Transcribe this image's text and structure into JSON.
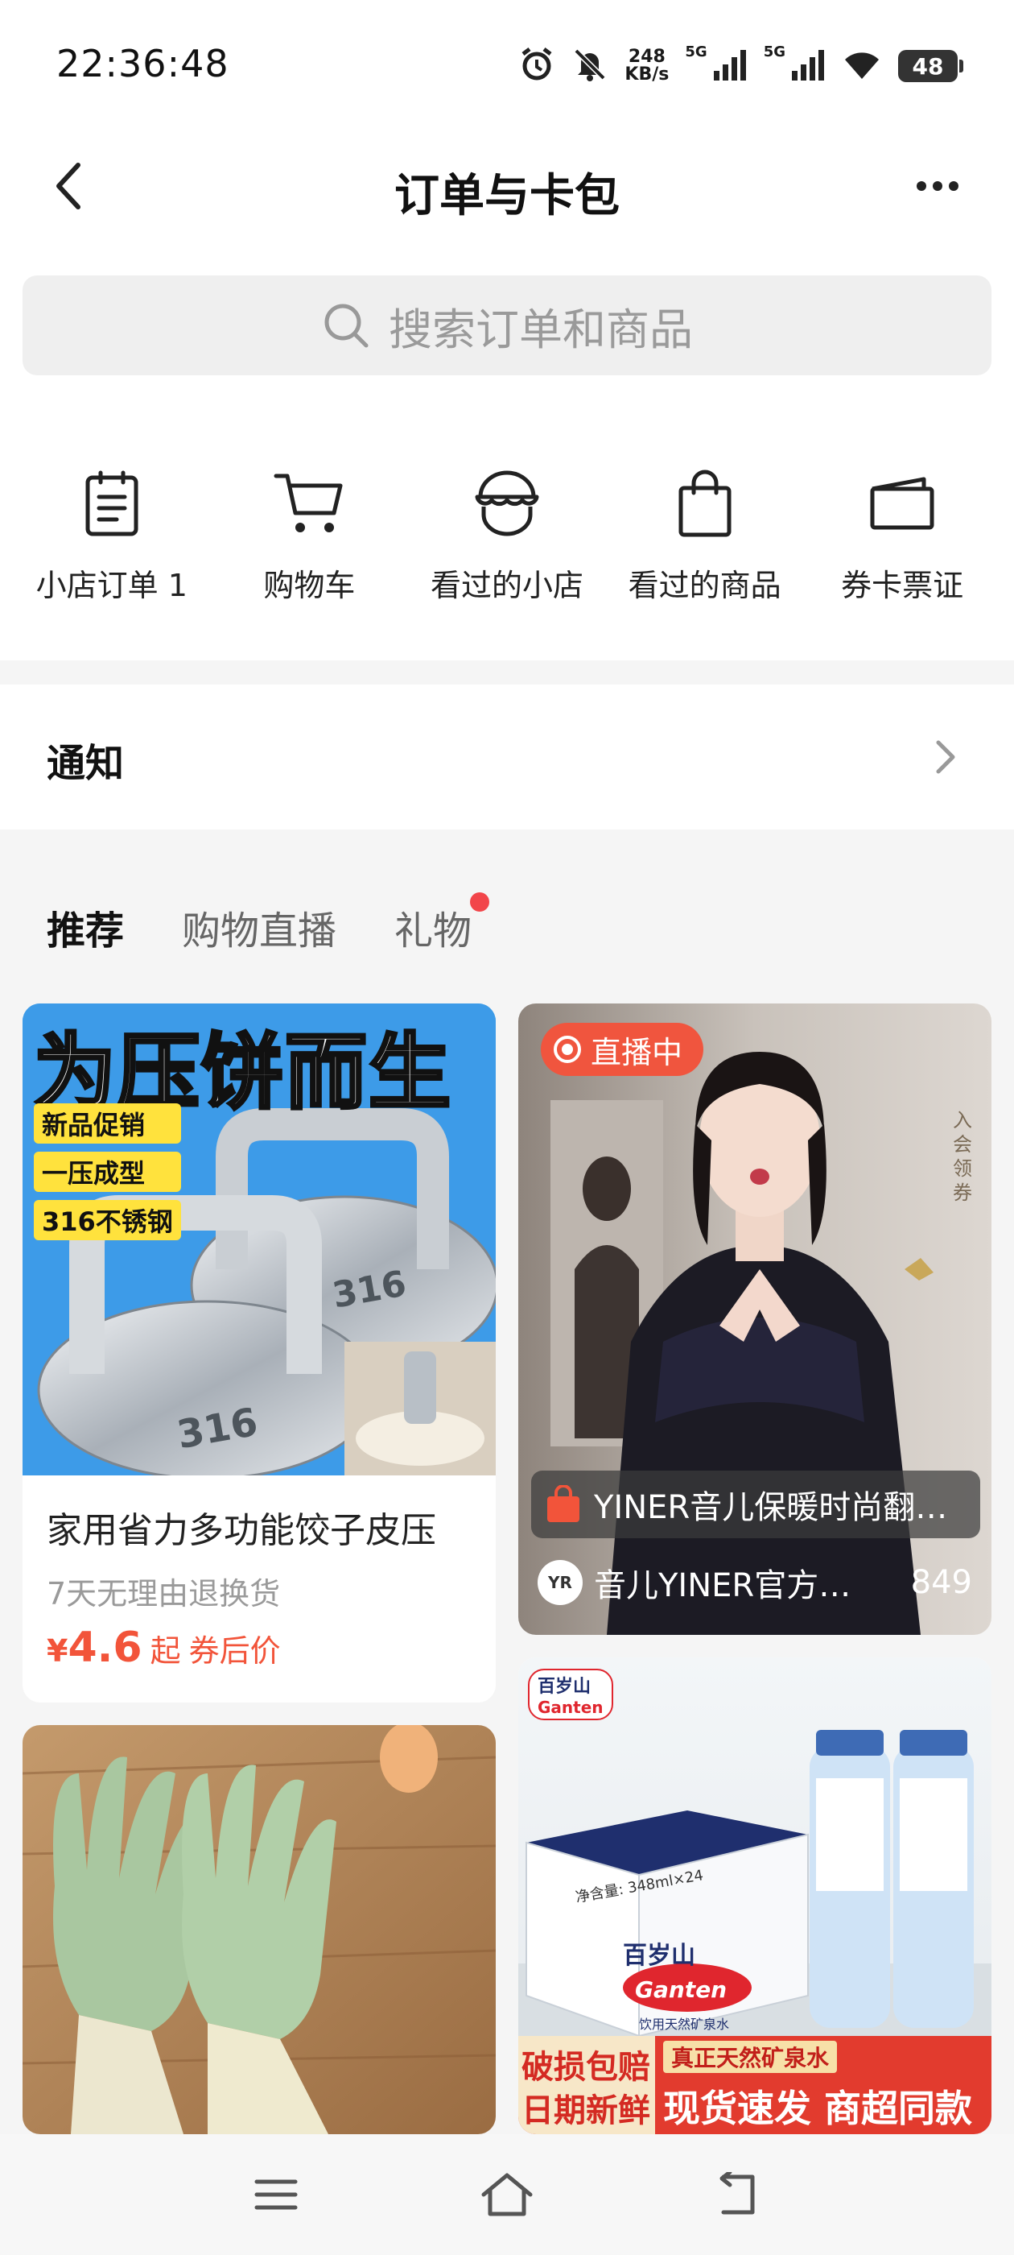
{
  "status_bar": {
    "time": "22:36:48",
    "net_speed_value": "248",
    "net_speed_unit": "KB/s",
    "signal_1_label": "5G",
    "signal_2_label": "5G",
    "battery": "48"
  },
  "nav": {
    "title": "订单与卡包"
  },
  "search": {
    "placeholder": "搜索订单和商品"
  },
  "shortcuts": [
    {
      "label": "小店订单 1",
      "icon": "clipboard-icon"
    },
    {
      "label": "购物车",
      "icon": "cart-icon"
    },
    {
      "label": "看过的小店",
      "icon": "shop-icon"
    },
    {
      "label": "看过的商品",
      "icon": "bag-icon"
    },
    {
      "label": "券卡票证",
      "icon": "wallet-icon"
    }
  ],
  "notice": {
    "label": "通知"
  },
  "tabs": [
    {
      "label": "推荐",
      "active": true
    },
    {
      "label": "购物直播",
      "active": false
    },
    {
      "label": "礼物",
      "active": false,
      "dot": true
    }
  ],
  "cards": {
    "press": {
      "img_headline": "为压饼而生",
      "img_tags": [
        "新品促销",
        "一压成型",
        "316不锈钢"
      ],
      "img_mark": "316",
      "title": "家用省力多功能饺子皮压",
      "sub": "7天无理由退换货",
      "price_symbol": "¥",
      "price": "4.6",
      "price_from": "起",
      "price_suffix": "券后价"
    },
    "live": {
      "badge": "直播中",
      "side_text": "入会领券",
      "product": "YINER音儿保暖时尚翻…",
      "shop": "音儿YINER官方…",
      "viewers": "849"
    },
    "water": {
      "brand": "百岁山",
      "brand_en": "Ganten",
      "box_text": "饮用天然矿泉水",
      "spec": "净含量: 348ml×24",
      "tag1": "破损包赔",
      "tag2": "日期新鲜",
      "tag3": "真正天然矿泉水",
      "tag4": "现货速发 商超同款"
    }
  },
  "colors": {
    "accent": "#f2543a",
    "live_badge": "#f0553e",
    "dot": "#f2454a"
  }
}
